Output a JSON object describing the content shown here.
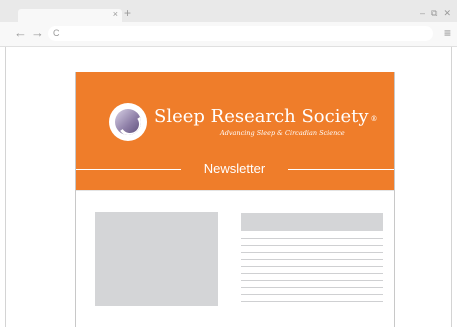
{
  "browser": {
    "tab_close": "×",
    "new_tab": "+",
    "minimize": "–",
    "restore": "⧉",
    "close": "✕",
    "back": "←",
    "forward": "→",
    "reload": "C",
    "menu": "≡"
  },
  "newsletter": {
    "org_name": "Sleep Research Society",
    "registered_mark": "®",
    "tagline": "Advancing Sleep & Circadian Science",
    "section_title": "Newsletter"
  },
  "colors": {
    "banner": "#ef7d2a",
    "placeholder": "#d4d5d7"
  }
}
